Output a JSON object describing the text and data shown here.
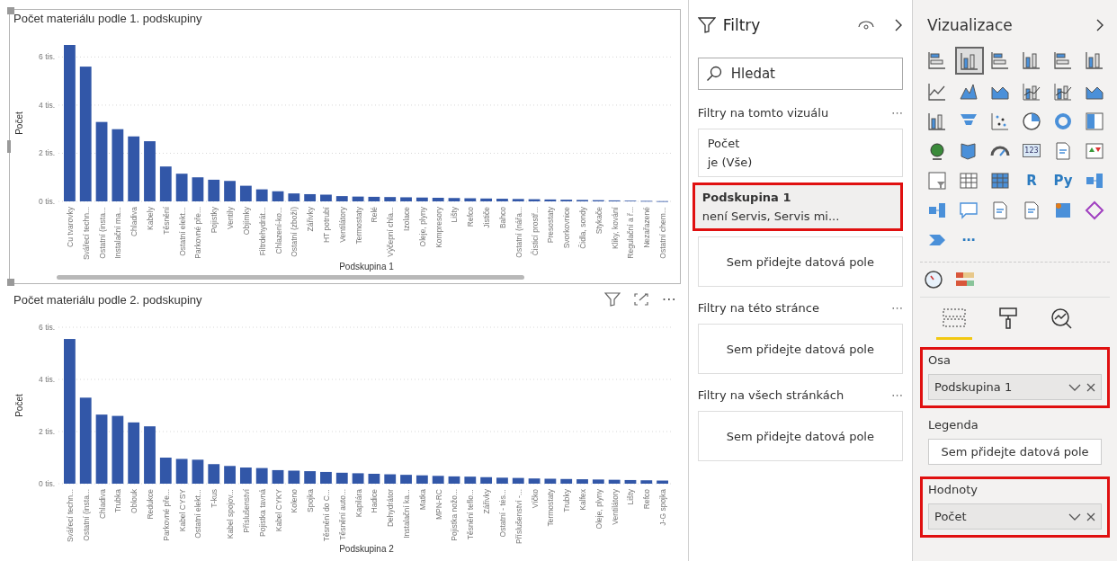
{
  "charts": [
    {
      "selected": true,
      "scrollbar": true,
      "chart_data": {
        "type": "bar",
        "title": "Počet materiálu podle 1. podskupiny",
        "xlabel": "Podskupina 1",
        "ylabel": "Počet",
        "grid": true,
        "ylim": [
          0,
          6.5
        ],
        "yticks": [
          {
            "value": 0,
            "label": "0 tis."
          },
          {
            "value": 2,
            "label": "2 tis."
          },
          {
            "value": 4,
            "label": "4 tis."
          },
          {
            "value": 6,
            "label": "6 tis."
          }
        ],
        "categories": [
          "Cu tvarovky",
          "Svářecí techn...",
          "Ostatní (insta...",
          "Instalační ma...",
          "Chladiva",
          "Kabely",
          "Těsnění",
          "Ostatní elekt...",
          "Parkovné pře...",
          "Pojistky",
          "Ventily",
          "Objímky",
          "Filtrdehydrát...",
          "Chlazení-ko...",
          "Ostatní (zboží)",
          "Zářivky",
          "HT potrubí",
          "Ventilátory",
          "Termostaty",
          "Relé",
          "Výčepní chla...",
          "Izolace",
          "Oleje, plyny",
          "Kompresory",
          "Lišty",
          "Refco",
          "Jističe",
          "Bahco",
          "Ostatní (nářa...",
          "Čisticí prostř...",
          "Presostaty",
          "Svorkovnice",
          "Čidla, sondy",
          "Stykače",
          "Kliky, kování",
          "Regulační a ř...",
          "Nezařazené",
          "Ostatní chem..."
        ],
        "series": [
          {
            "color": "#3257a8",
            "values": [
              6.5,
              5.6,
              3.3,
              3.0,
              2.7,
              2.5,
              1.45,
              1.15,
              1.0,
              0.9,
              0.85,
              0.65,
              0.5,
              0.42,
              0.33,
              0.3,
              0.28,
              0.22,
              0.2,
              0.19,
              0.18,
              0.17,
              0.16,
              0.15,
              0.14,
              0.13,
              0.12,
              0.11,
              0.1,
              0.09,
              0.08,
              0.07,
              0.06,
              0.05,
              0.04,
              0.03,
              0.02,
              0.01
            ]
          }
        ]
      }
    },
    {
      "selected": false,
      "header_more": "⋯",
      "chart_data": {
        "type": "bar",
        "title": "Počet materiálu podle 2. podskupiny",
        "xlabel": "Podskupina 2",
        "ylabel": "Počet",
        "grid": true,
        "ylim": [
          0,
          6
        ],
        "yticks": [
          {
            "value": 0,
            "label": "0 tis."
          },
          {
            "value": 2,
            "label": "2 tis."
          },
          {
            "value": 4,
            "label": "4 tis."
          },
          {
            "value": 6,
            "label": "6 tis."
          }
        ],
        "categories": [
          "Svářecí techn...",
          "Ostatní (insta...",
          "Chladiva",
          "Trubka",
          "Oblouk",
          "Redukce",
          "Parkovné pře...",
          "Kabel CYSY",
          "Ostatní elekt...",
          "T-kus",
          "Kabel spojov...",
          "Příslušenství",
          "Pojistka tavná",
          "Kabel CYKY",
          "Koleno",
          "Spojka",
          "Těsnění do C...",
          "Těsnění auto...",
          "Kapilára",
          "Hadice",
          "Dehydrátor",
          "Instalační ka...",
          "Matka",
          "MPN-RC",
          "Pojistka nožo...",
          "Těsnění teflo...",
          "Zářivky",
          "Ostatní - tės...",
          "Příslušenství -...",
          "Víčko",
          "Termostaty",
          "Trubky",
          "Kalfex",
          "Oleje, plyny",
          "Ventilátory",
          "Lišty",
          "Refco",
          "J-G spojka"
        ],
        "series": [
          {
            "color": "#3257a8",
            "values": [
              5.55,
              3.3,
              2.65,
              2.6,
              2.35,
              2.2,
              1.0,
              0.95,
              0.92,
              0.75,
              0.68,
              0.62,
              0.6,
              0.52,
              0.5,
              0.48,
              0.45,
              0.42,
              0.4,
              0.38,
              0.36,
              0.34,
              0.32,
              0.3,
              0.28,
              0.27,
              0.25,
              0.23,
              0.22,
              0.2,
              0.19,
              0.18,
              0.17,
              0.16,
              0.15,
              0.14,
              0.13,
              0.12
            ]
          }
        ]
      }
    }
  ],
  "filters": {
    "title": "Filtry",
    "search": {
      "placeholder": "Hledat"
    },
    "sections": [
      {
        "title": "Filtry na tomto vizuálu",
        "more": "⋯",
        "cards": [
          {
            "name": "Počet",
            "condition": "je (Vše)",
            "highlighted": false
          },
          {
            "name": "Podskupina 1",
            "condition": "není Servis, Servis mi...",
            "highlighted": true
          }
        ],
        "drop": "Sem přidejte datová pole"
      },
      {
        "title": "Filtry na této stránce",
        "more": "⋯",
        "drop": "Sem přidejte datová pole"
      },
      {
        "title": "Filtry na všech stránkách",
        "more": "⋯",
        "drop": "Sem přidejte datová pole"
      }
    ]
  },
  "visualizations": {
    "title": "Vizualizace",
    "gallery": [
      {
        "selected": false
      },
      {
        "selected": true
      },
      {
        "selected": false
      },
      {
        "selected": false
      },
      {
        "selected": false
      },
      {
        "selected": false
      },
      {
        "selected": false
      },
      {
        "selected": false
      },
      {
        "selected": false
      },
      {
        "selected": false
      },
      {
        "selected": false
      },
      {
        "selected": false
      },
      {
        "selected": false
      },
      {
        "selected": false
      },
      {
        "selected": false
      },
      {
        "selected": false
      },
      {
        "selected": false
      },
      {
        "selected": false
      },
      {
        "selected": false
      },
      {
        "selected": false
      },
      {
        "selected": false
      },
      {
        "selected": false,
        "text": "123"
      },
      {
        "selected": false
      },
      {
        "selected": false
      },
      {
        "selected": false
      },
      {
        "selected": false
      },
      {
        "selected": false
      },
      {
        "selected": false,
        "text": "R"
      },
      {
        "selected": false,
        "text": "Py"
      },
      {
        "selected": false
      },
      {
        "selected": false
      },
      {
        "selected": false
      },
      {
        "selected": false
      },
      {
        "selected": false
      },
      {
        "selected": false
      },
      {
        "selected": false
      },
      {
        "selected": false
      },
      {
        "selected": false,
        "text": "⋯"
      }
    ],
    "tabs": [
      {
        "selected": true
      },
      {
        "selected": false
      },
      {
        "selected": false
      }
    ],
    "wells": [
      {
        "label": "Osa",
        "field": "Podskupina 1",
        "highlighted": true
      },
      {
        "label": "Legenda",
        "placeholder": "Sem přidejte datová pole",
        "highlighted": false
      },
      {
        "label": "Hodnoty",
        "field": "Počet",
        "highlighted": true
      }
    ]
  }
}
